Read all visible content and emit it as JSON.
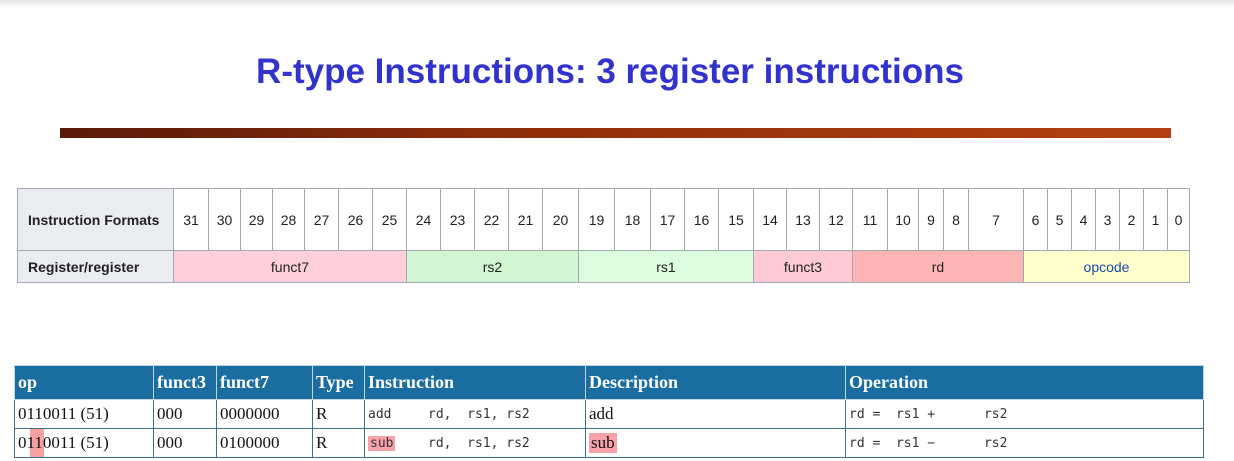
{
  "title": "R-type Instructions:  3 register instructions",
  "format_table": {
    "header_label": "Instruction Formats",
    "bits": [
      "31",
      "30",
      "29",
      "28",
      "27",
      "26",
      "25",
      "24",
      "23",
      "22",
      "21",
      "20",
      "19",
      "18",
      "17",
      "16",
      "15",
      "14",
      "13",
      "12",
      "11",
      "10",
      "9",
      "8",
      "7",
      "6",
      "5",
      "4",
      "3",
      "2",
      "1",
      "0"
    ],
    "row_label": "Register/register",
    "fields": {
      "funct7": "funct7",
      "rs2": "rs2",
      "rs1": "rs1",
      "funct3": "funct3",
      "rd": "rd",
      "opcode": "opcode"
    }
  },
  "instr_table": {
    "headers": [
      "op",
      "funct3",
      "funct7",
      "Type",
      "Instruction",
      "Description",
      "Operation"
    ],
    "rows": [
      {
        "op": "0110011 (51)",
        "funct3": "000",
        "funct7": "0000000",
        "type": "R",
        "mnemonic": "add",
        "operands": [
          "rd,",
          "rs1,",
          "rs2"
        ],
        "description": "add",
        "operation": [
          "rd =",
          "rs1 +",
          "rs2"
        ]
      },
      {
        "op": "0110011 (51)",
        "funct3": "000",
        "funct7": "0100000",
        "type": "R",
        "mnemonic": "sub",
        "operands": [
          "rd,",
          "rs1,",
          "rs2"
        ],
        "description": "sub",
        "operation": [
          "rd =",
          "rs1 −",
          "rs2"
        ]
      }
    ]
  },
  "colors": {
    "title": "#3232cc",
    "header_bg": "#1a6da1",
    "highlight": "#f7a1a8",
    "funct7": "#ffd0dc",
    "rs2": "#d2f5d2",
    "rs1": "#ddfbdd",
    "funct3": "#ffcad4",
    "rd": "#ffb5b5",
    "opcode": "#ffffcc"
  }
}
